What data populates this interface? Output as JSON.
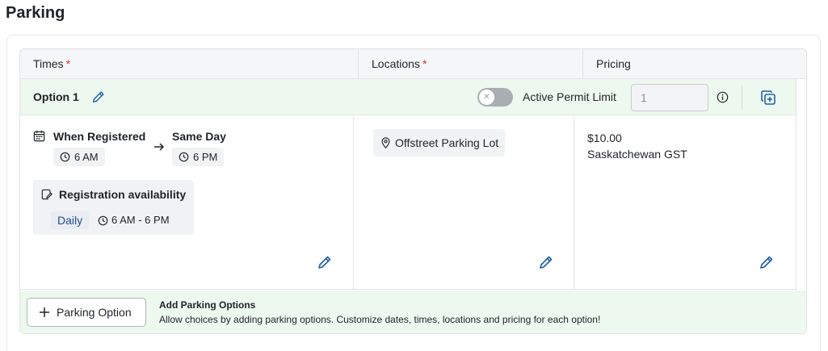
{
  "page": {
    "title": "Parking"
  },
  "table": {
    "headers": {
      "times": "Times",
      "locations": "Locations",
      "pricing": "Pricing",
      "required_marker": "*"
    }
  },
  "option": {
    "label": "Option 1",
    "active_permit_limit": {
      "label": "Active Permit Limit",
      "enabled": false,
      "value": "1"
    },
    "times": {
      "start_label": "When Registered",
      "start_time": "6 AM",
      "end_label": "Same Day",
      "end_time": "6 PM",
      "availability": {
        "title": "Registration availability",
        "frequency": "Daily",
        "hours": "6 AM - 6 PM"
      }
    },
    "locations": [
      "Offstreet Parking Lot"
    ],
    "pricing": {
      "amount": "$10.00",
      "tax": "Saskatchewan GST"
    }
  },
  "footer": {
    "add_button_label": "Parking Option",
    "title": "Add Parking Options",
    "description": "Allow choices by adding parking options. Customize dates, times, locations and pricing for each option!"
  },
  "colors": {
    "accent_blue": "#1f5fa8",
    "option_bar_green": "#edf8ee",
    "required_red": "#d93025"
  }
}
